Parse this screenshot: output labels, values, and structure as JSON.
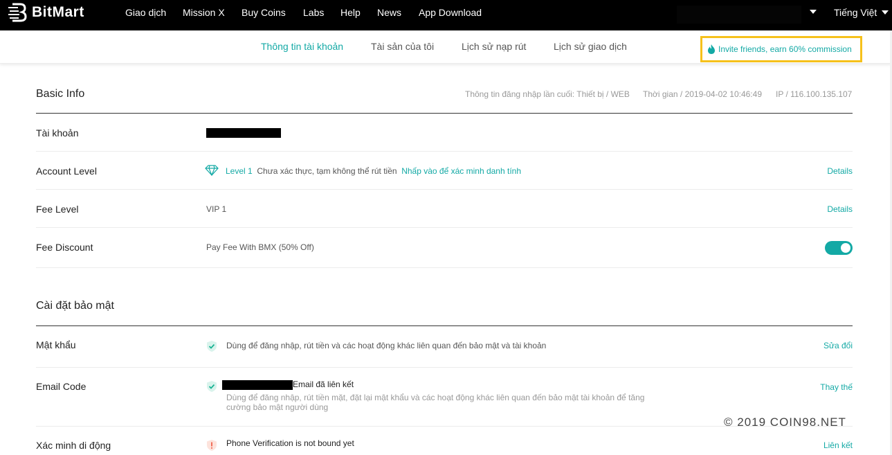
{
  "brand": {
    "name": "BitMart",
    "accent": "#13a9a5",
    "highlight": "#f6c11b"
  },
  "topnav": {
    "items": [
      "Giao dịch",
      "Mission X",
      "Buy Coins",
      "Labs",
      "Help",
      "News",
      "App Download"
    ],
    "language": "Tiếng Việt"
  },
  "subnav": {
    "tabs": [
      "Thông tin tài khoản",
      "Tài sản của tôi",
      "Lịch sử nạp rút",
      "Lịch sử giao dịch"
    ],
    "active_tab": "Thông tin tài khoản",
    "invite": {
      "icon": "fire-icon",
      "text": "Invite friends, earn 60% commission"
    }
  },
  "basic_info": {
    "title": "Basic Info",
    "last_login": "Thông tin đăng nhập lần cuối: Thiết bị / WEB",
    "time": "Thời gian / 2019-04-02 10:46:49",
    "ip": "IP / 116.100.135.107",
    "rows": {
      "account": {
        "label": "Tài khoản"
      },
      "level": {
        "label": "Account Level",
        "icon": "diamond-icon",
        "level_text": "Level 1",
        "status": "Chưa xác thực, tạm không thể rút tiền",
        "verify_link": "Nhấp vào để xác minh danh tính",
        "action": "Details"
      },
      "fee_level": {
        "label": "Fee Level",
        "value": "VIP 1",
        "action": "Details"
      },
      "fee_discount": {
        "label": "Fee Discount",
        "value": "Pay Fee With BMX (50% Off)",
        "enabled": true
      }
    }
  },
  "security": {
    "title": "Cài đặt bảo mật",
    "rows": {
      "password": {
        "label": "Mật khẩu",
        "icon": "shield-check-icon",
        "desc": "Dùng để đăng nhập, rút tiền và các hoạt động khác liên quan đến bảo mật và tài khoản",
        "action": "Sửa đổi"
      },
      "email": {
        "label": "Email Code",
        "icon": "shield-check-icon",
        "status": "Email đã liên kết",
        "desc": "Dùng để đăng nhập, rút tiền mặt, đặt lại mật khẩu và các hoạt động khác liên quan đến bảo mật tài khoản để tăng cường bảo mật người dùng",
        "action": "Thay thế"
      },
      "phone": {
        "label": "Xác minh di động",
        "icon": "shield-alert-icon",
        "status": "Phone Verification is not bound yet",
        "action": "Liên kết"
      }
    }
  },
  "watermark": "© 2019 COIN98.NET"
}
